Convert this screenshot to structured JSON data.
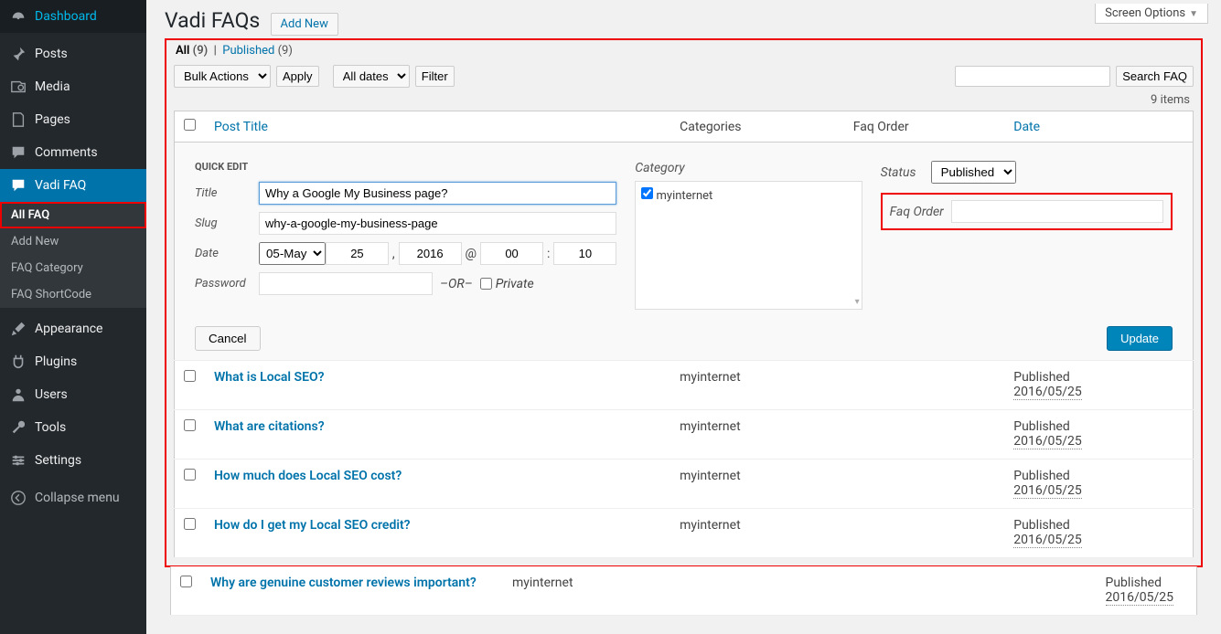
{
  "screen_options": "Screen Options",
  "page_title": "Vadi FAQs",
  "add_new": "Add New",
  "sidebar": {
    "items": [
      {
        "label": "Dashboard",
        "icon": "dashboard"
      },
      {
        "label": "Posts",
        "icon": "pin"
      },
      {
        "label": "Media",
        "icon": "media"
      },
      {
        "label": "Pages",
        "icon": "page"
      },
      {
        "label": "Comments",
        "icon": "comment"
      },
      {
        "label": "Vadi FAQ",
        "icon": "comment",
        "active": true
      },
      {
        "label": "Appearance",
        "icon": "brush"
      },
      {
        "label": "Plugins",
        "icon": "plug"
      },
      {
        "label": "Users",
        "icon": "user"
      },
      {
        "label": "Tools",
        "icon": "wrench"
      },
      {
        "label": "Settings",
        "icon": "settings"
      }
    ],
    "sub": [
      "All FAQ",
      "Add New",
      "FAQ Category",
      "FAQ ShortCode"
    ],
    "collapse": "Collapse menu"
  },
  "subsubsub": {
    "all_label": "All",
    "all_count": "(9)",
    "pub_label": "Published",
    "pub_count": "(9)"
  },
  "bulk": {
    "label": "Bulk Actions",
    "apply": "Apply"
  },
  "dates": {
    "label": "All dates",
    "filter": "Filter"
  },
  "search": {
    "placeholder": "",
    "button": "Search FAQ"
  },
  "item_count": "9 items",
  "columns": {
    "title": "Post Title",
    "cat": "Categories",
    "order": "Faq Order",
    "date": "Date"
  },
  "quickedit": {
    "heading": "QUICK EDIT",
    "title_label": "Title",
    "title_value": "Why a Google My Business page?",
    "slug_label": "Slug",
    "slug_value": "why-a-google-my-business-page",
    "date_label": "Date",
    "month": "05-May",
    "day": "25",
    "year": "2016",
    "at": "@",
    "hour": "00",
    "colon": ":",
    "min": "10",
    "password_label": "Password",
    "password_value": "",
    "or": "–OR–",
    "private": "Private",
    "category_label": "Category",
    "cat_option": "myinternet",
    "status_label": "Status",
    "status_value": "Published",
    "faqorder_label": "Faq Order",
    "faqorder_value": "",
    "cancel": "Cancel",
    "update": "Update"
  },
  "rows": [
    {
      "title": "What is Local SEO?",
      "cat": "myinternet",
      "status": "Published",
      "date": "2016/05/25"
    },
    {
      "title": "What are citations?",
      "cat": "myinternet",
      "status": "Published",
      "date": "2016/05/25"
    },
    {
      "title": "How much does Local SEO cost?",
      "cat": "myinternet",
      "status": "Published",
      "date": "2016/05/25"
    },
    {
      "title": "How do I get my Local SEO credit?",
      "cat": "myinternet",
      "status": "Published",
      "date": "2016/05/25"
    },
    {
      "title": "Why are genuine customer reviews important?",
      "cat": "myinternet",
      "status": "Published",
      "date": "2016/05/25"
    }
  ]
}
